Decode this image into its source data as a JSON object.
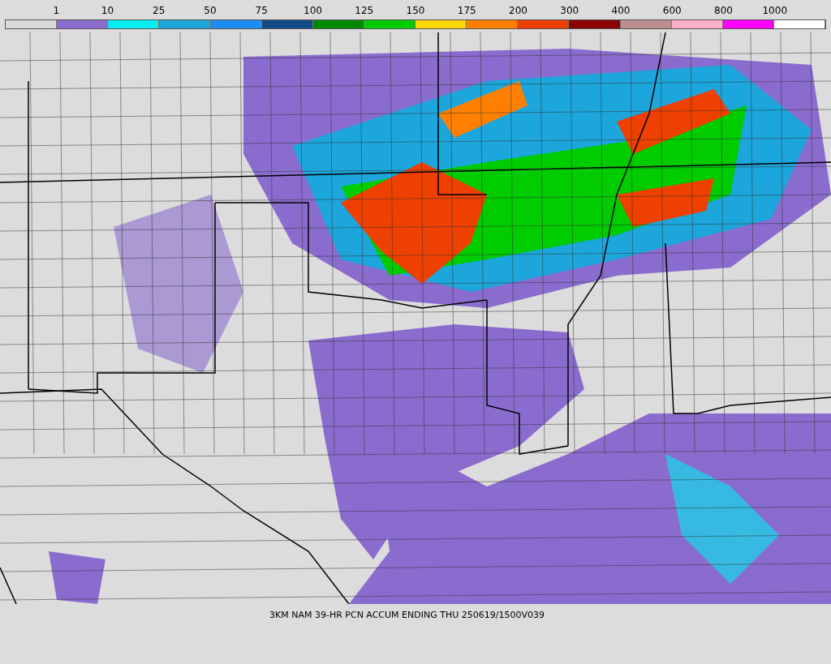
{
  "legend": {
    "bins": [
      {
        "color": "#d9d9d9",
        "label": "1"
      },
      {
        "color": "#8a6ccf",
        "label": "10"
      },
      {
        "color": "#00eeee",
        "label": "25"
      },
      {
        "color": "#1ca6dc",
        "label": "50"
      },
      {
        "color": "#1e8cf0",
        "label": "75"
      },
      {
        "color": "#124a86",
        "label": "100"
      },
      {
        "color": "#008800",
        "label": "125"
      },
      {
        "color": "#00cc00",
        "label": "150"
      },
      {
        "color": "#ffd700",
        "label": "175"
      },
      {
        "color": "#ff8000",
        "label": "200"
      },
      {
        "color": "#ee4000",
        "label": "300"
      },
      {
        "color": "#8b0000",
        "label": "400"
      },
      {
        "color": "#bc8f8f",
        "label": "600"
      },
      {
        "color": "#ffaec9",
        "label": "800"
      },
      {
        "color": "#ff00ff",
        "label": "1000"
      },
      {
        "color": "#ffffff"
      }
    ]
  },
  "caption": "3KM NAM 39-HR PCN ACCUM ENDING THU 250619/1500V039"
}
